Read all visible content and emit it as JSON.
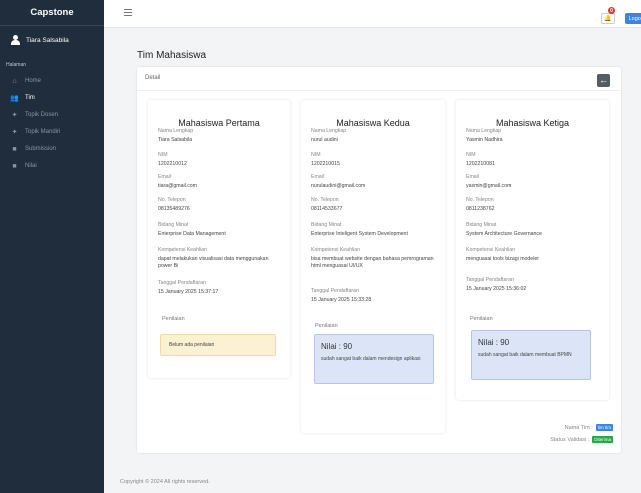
{
  "sidebar": {
    "brand": "Capstone",
    "user_name": "Tiara Salsabila",
    "header": "Halaman",
    "items": [
      {
        "label": "Home",
        "icon": "home-icon",
        "glyph": "⌂",
        "active": false
      },
      {
        "label": "Tim",
        "icon": "users-icon",
        "glyph": "👥",
        "active": true
      },
      {
        "label": "Topik Dosen",
        "icon": "lightbulb-icon",
        "glyph": "✦",
        "active": false
      },
      {
        "label": "Topik Mandiri",
        "icon": "lightbulb-icon",
        "glyph": "✦",
        "active": false
      },
      {
        "label": "Submission",
        "icon": "file-icon",
        "glyph": "■",
        "active": false
      },
      {
        "label": "Nilai",
        "icon": "file-icon",
        "glyph": "■",
        "active": false
      }
    ]
  },
  "topbar": {
    "notification_count": "0",
    "logout_label": "Logout"
  },
  "page": {
    "title": "Tim Mahasiswa",
    "card_label": "Detail"
  },
  "labels": {
    "nama": "Nama Lengkap",
    "nim": "NIM",
    "email": "Email",
    "telepon": "No. Telepon",
    "minat": "Bidang Minat",
    "keahlian": "Kompetensi Keahlian",
    "tanggal": "Tanggal Pendaftaran",
    "penilaian": "Penilaian"
  },
  "students": [
    {
      "heading": "Mahasiswa Pertama",
      "nama": "Tiara Salsabila",
      "nim": "1202210012",
      "email": "tiara@gmail.com",
      "telepon": "08135489276",
      "minat": "Enterprise Data Management",
      "keahlian": "dapat melakukan visualisasi data menggunakan power Bi",
      "tanggal": "15 January 2025 15:37:17",
      "nilai_text": "Belum ada penilaian",
      "nilai_score": "",
      "nilai_comment": ""
    },
    {
      "heading": "Mahasiswa Kedua",
      "nama": "nurul audini",
      "nim": "1202210015",
      "email": "nurulaudini@gmail.com",
      "telepon": "08114533677",
      "minat": "Enterprise Inteligent System Development",
      "keahlian": "bisa membuat website dengan bahasa pemrograman html menguasai UI/UX",
      "tanggal": "15 January 2025 15:33:28",
      "nilai_text": "",
      "nilai_score": "Nilai : 90",
      "nilai_comment": "sudah sangat baik dalam mendesign aplikasi"
    },
    {
      "heading": "Mahasiswa Ketiga",
      "nama": "Yasmin Nadhira",
      "nim": "1202210081",
      "email": "yasmin@gmail.com",
      "telepon": "0811238762",
      "minat": "System Architecture Governance",
      "keahlian": "menguasai tools bizagi modeler",
      "tanggal": "15 January 2025 15:36:02",
      "nilai_text": "",
      "nilai_score": "Nilai : 90",
      "nilai_comment": "sudah sangat baik dalam membuat BPMN"
    }
  ],
  "team": {
    "name_label": "Nama Tim :",
    "name_value": "tim tim",
    "status_label": "Status Validasi :",
    "status_value": "Diterima"
  },
  "footer": "Copyright © 2024 All rights reserved."
}
